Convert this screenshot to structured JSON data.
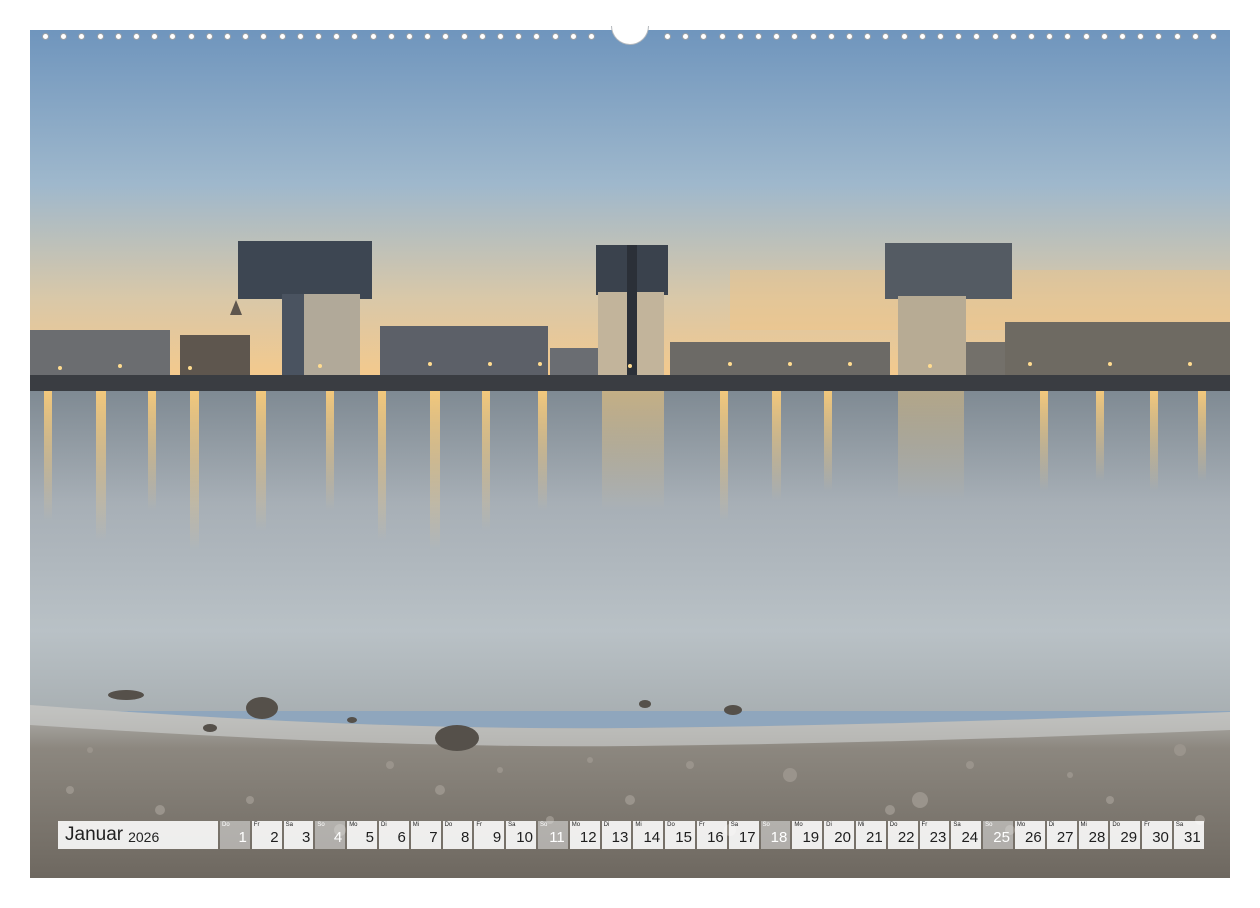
{
  "calendar": {
    "month": "Januar",
    "year": "2026",
    "days": [
      {
        "num": "1",
        "wd": "Do",
        "weekend": true
      },
      {
        "num": "2",
        "wd": "Fr",
        "weekend": false
      },
      {
        "num": "3",
        "wd": "Sa",
        "weekend": false
      },
      {
        "num": "4",
        "wd": "So",
        "weekend": true
      },
      {
        "num": "5",
        "wd": "Mo",
        "weekend": false
      },
      {
        "num": "6",
        "wd": "Di",
        "weekend": false
      },
      {
        "num": "7",
        "wd": "Mi",
        "weekend": false
      },
      {
        "num": "8",
        "wd": "Do",
        "weekend": false
      },
      {
        "num": "9",
        "wd": "Fr",
        "weekend": false
      },
      {
        "num": "10",
        "wd": "Sa",
        "weekend": false
      },
      {
        "num": "11",
        "wd": "So",
        "weekend": true
      },
      {
        "num": "12",
        "wd": "Mo",
        "weekend": false
      },
      {
        "num": "13",
        "wd": "Di",
        "weekend": false
      },
      {
        "num": "14",
        "wd": "Mi",
        "weekend": false
      },
      {
        "num": "15",
        "wd": "Do",
        "weekend": false
      },
      {
        "num": "16",
        "wd": "Fr",
        "weekend": false
      },
      {
        "num": "17",
        "wd": "Sa",
        "weekend": false
      },
      {
        "num": "18",
        "wd": "So",
        "weekend": true
      },
      {
        "num": "19",
        "wd": "Mo",
        "weekend": false
      },
      {
        "num": "20",
        "wd": "Di",
        "weekend": false
      },
      {
        "num": "21",
        "wd": "Mi",
        "weekend": false
      },
      {
        "num": "22",
        "wd": "Do",
        "weekend": false
      },
      {
        "num": "23",
        "wd": "Fr",
        "weekend": false
      },
      {
        "num": "24",
        "wd": "Sa",
        "weekend": false
      },
      {
        "num": "25",
        "wd": "So",
        "weekend": true
      },
      {
        "num": "26",
        "wd": "Mo",
        "weekend": false
      },
      {
        "num": "27",
        "wd": "Di",
        "weekend": false
      },
      {
        "num": "28",
        "wd": "Mi",
        "weekend": false
      },
      {
        "num": "29",
        "wd": "Do",
        "weekend": false
      },
      {
        "num": "30",
        "wd": "Fr",
        "weekend": false
      },
      {
        "num": "31",
        "wd": "Sa",
        "weekend": false
      }
    ]
  },
  "colors": {
    "sky_top": "#7a9ec3",
    "sky_horizon": "#f2c98a",
    "water": "#9aa8b5",
    "building": "#3c4450",
    "lights": "#ffd68a",
    "shore": "#8e8a84"
  }
}
